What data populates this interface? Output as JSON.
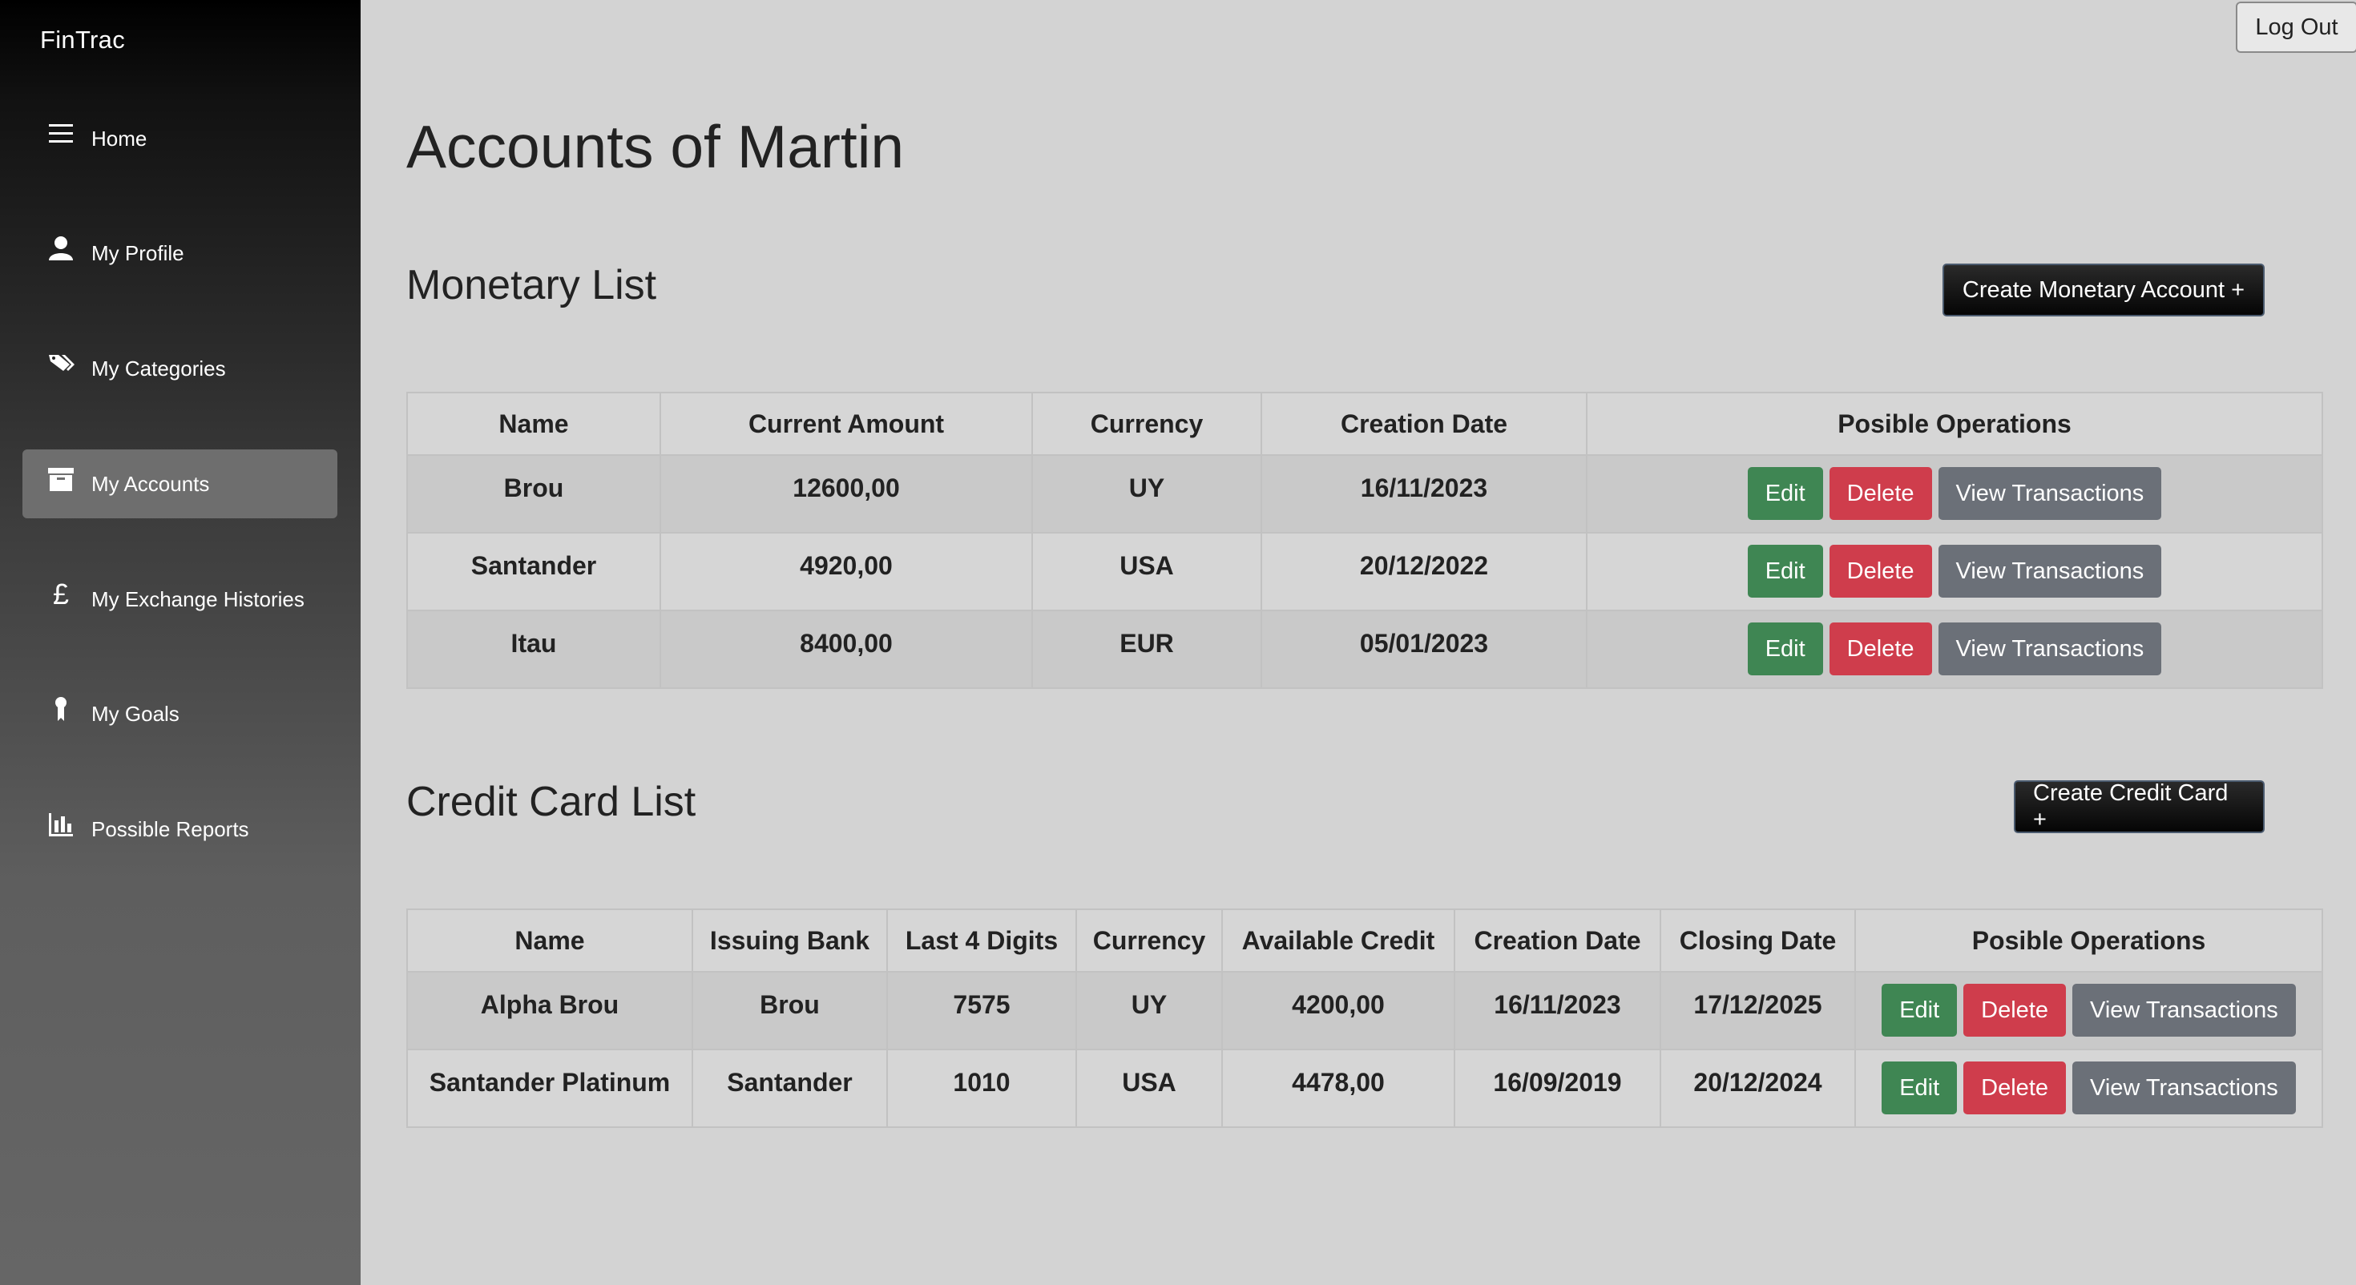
{
  "app": {
    "brand": "FinTrac"
  },
  "sidebar": {
    "items": [
      {
        "label": "Home",
        "icon": "menu-icon",
        "active": false
      },
      {
        "label": "My Profile",
        "icon": "user-icon",
        "active": false
      },
      {
        "label": "My Categories",
        "icon": "tags-icon",
        "active": false
      },
      {
        "label": "My Accounts",
        "icon": "archive-icon",
        "active": true
      },
      {
        "label": "My Exchange Histories",
        "icon": "pound-icon",
        "active": false
      },
      {
        "label": "My Goals",
        "icon": "award-icon",
        "active": false
      },
      {
        "label": "Possible Reports",
        "icon": "bar-chart-icon",
        "active": false
      }
    ]
  },
  "header": {
    "logout_label": "Log Out"
  },
  "page": {
    "title": "Accounts of Martin"
  },
  "monetary": {
    "title": "Monetary List",
    "create_label": "Create Monetary Account +",
    "columns": [
      "Name",
      "Current Amount",
      "Currency",
      "Creation Date",
      "Posible Operations"
    ],
    "rows": [
      {
        "name": "Brou",
        "amount": "12600,00",
        "currency": "UY",
        "created": "16/11/2023"
      },
      {
        "name": "Santander",
        "amount": "4920,00",
        "currency": "USA",
        "created": "20/12/2022"
      },
      {
        "name": "Itau",
        "amount": "8400,00",
        "currency": "EUR",
        "created": "05/01/2023"
      }
    ]
  },
  "credit": {
    "title": "Credit Card List",
    "create_label": "Create Credit Card +",
    "columns": [
      "Name",
      "Issuing Bank",
      "Last 4 Digits",
      "Currency",
      "Available Credit",
      "Creation Date",
      "Closing Date",
      "Posible Operations"
    ],
    "rows": [
      {
        "name": "Alpha Brou",
        "bank": "Brou",
        "last4": "7575",
        "currency": "UY",
        "available": "4200,00",
        "created": "16/11/2023",
        "closing": "17/12/2025"
      },
      {
        "name": "Santander Platinum",
        "bank": "Santander",
        "last4": "1010",
        "currency": "USA",
        "available": "4478,00",
        "created": "16/09/2019",
        "closing": "20/12/2024"
      }
    ]
  },
  "ops": {
    "edit": "Edit",
    "delete": "Delete",
    "view": "View Transactions"
  },
  "colors": {
    "edit": "#3f8653",
    "delete": "#cf3d4c",
    "view": "#6b7078",
    "background": "#d3d3d3"
  }
}
